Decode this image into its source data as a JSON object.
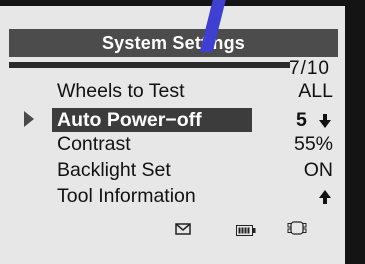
{
  "header": {
    "title": "System Settings",
    "page_indicator": "7/10"
  },
  "menu": {
    "items": [
      {
        "label": "Wheels to Test",
        "value": "ALL"
      },
      {
        "label": "Auto Power−off",
        "value": "5",
        "selected": true
      },
      {
        "label": "Contrast",
        "value": "55%"
      },
      {
        "label": "Backlight Set",
        "value": "ON"
      },
      {
        "label": "Tool Information",
        "value": ""
      }
    ]
  },
  "status_bar": {
    "icons": [
      "mail-icon",
      "battery-icon",
      "car-icon"
    ]
  },
  "colors": {
    "screen_bg": "#e7e7e7",
    "title_bar": "#4c4c4c",
    "highlight": "#3c3c3c",
    "text": "#111111",
    "accent_stripe": "#3f3fd2"
  }
}
